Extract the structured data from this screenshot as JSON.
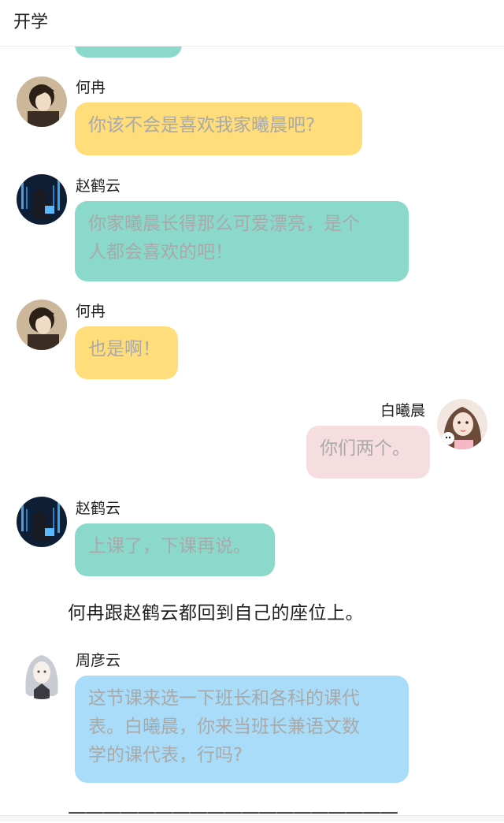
{
  "header": {
    "title": "开学"
  },
  "colors": {
    "yellow": "#ffdd7a",
    "teal": "#8ad9cb",
    "pink": "#f5dde0",
    "blue": "#a8dcf8"
  },
  "messages": [
    {
      "sender": "何冉",
      "text": "你该不会是喜欢我家曦晨吧?",
      "color": "yellow"
    },
    {
      "sender": "赵鹤云",
      "line1": "你家曦晨长得那么可爱漂亮，是个",
      "line2": "人都会喜欢的吧！",
      "color": "teal"
    },
    {
      "sender": "何冉",
      "text": "也是啊！",
      "color": "yellow"
    },
    {
      "sender": "白曦晨",
      "text": "你们两个。",
      "color": "pink"
    },
    {
      "sender": "赵鹤云",
      "text": "上课了，下课再说。",
      "color": "teal"
    },
    {
      "sender": "周彦云",
      "line1": "这节课来选一下班长和各科的课代",
      "line2": "表。白曦晨，你来当班长兼语文数",
      "line3": "学的课代表，行吗?",
      "color": "blue"
    }
  ],
  "narration": "何冉跟赵鹤云都回到自己的座位上。",
  "divider": "———————————————————"
}
